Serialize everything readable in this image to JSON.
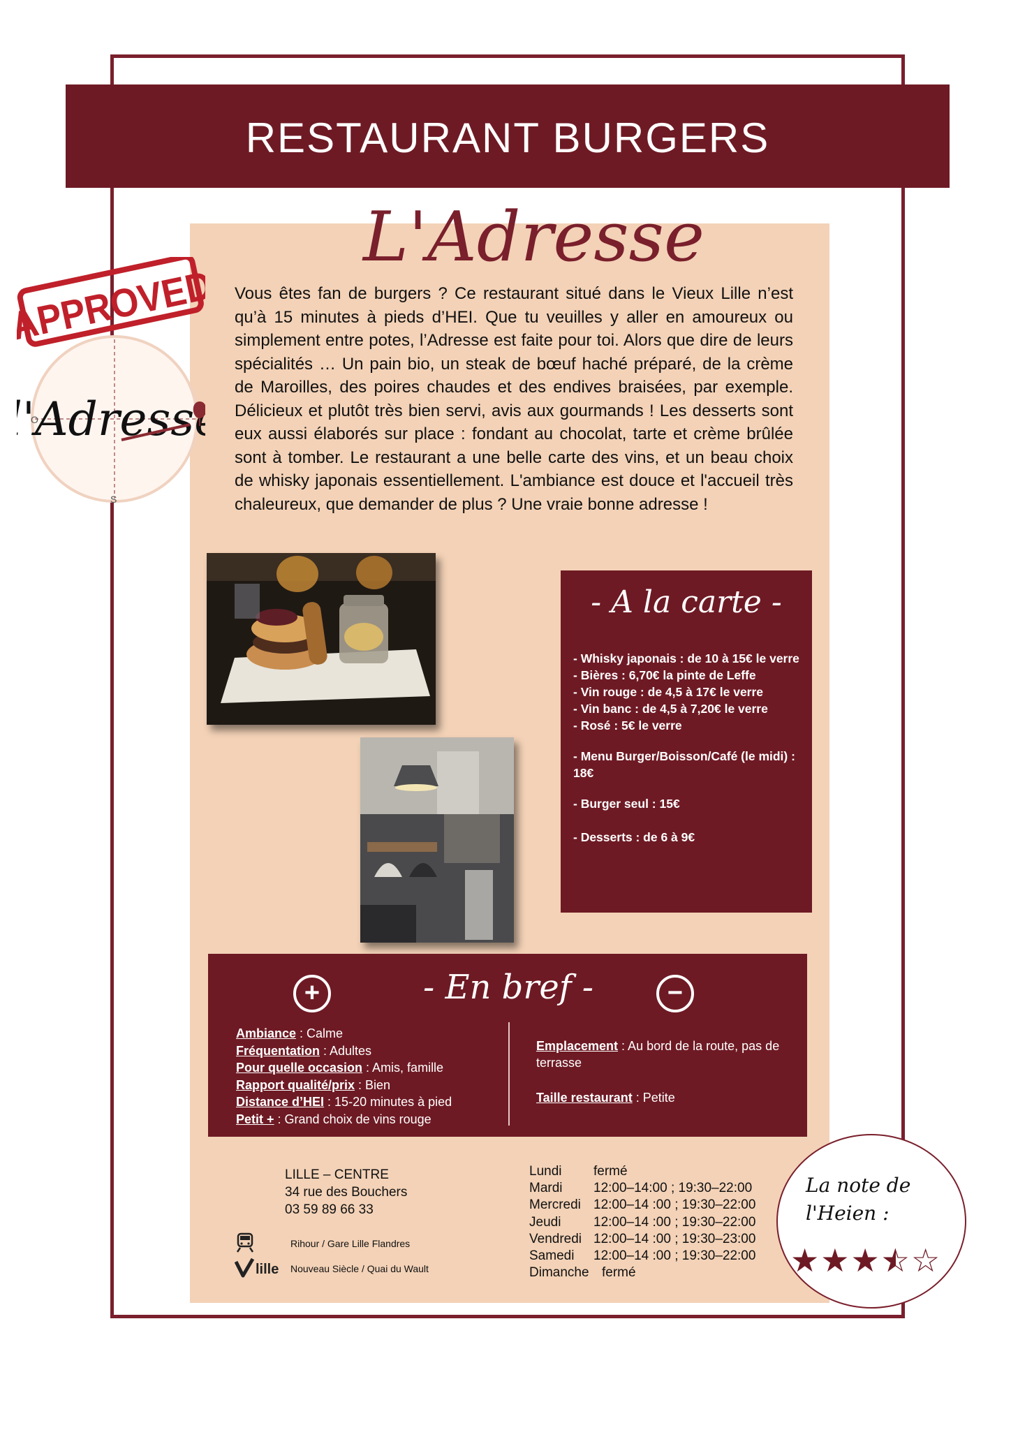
{
  "header": {
    "title": "RESTAURANT BURGERS"
  },
  "brand": {
    "name": "L'Adresse",
    "logo_text": "l'Adresse",
    "stamp_text": "APPROVED",
    "compass_w": "O",
    "compass_s": "S"
  },
  "intro": "Vous êtes fan de burgers ? Ce restaurant situé dans le Vieux Lille n’est qu’à 15 minutes à pieds d’HEI. Que tu veuilles y aller en amoureux ou simplement entre potes, l’Adresse est faite pour toi. Alors que dire de leurs spécialités … Un pain bio, un steak de bœuf haché préparé, de la crème de Maroilles, des poires chaudes et des endives braisées, par exemple. Délicieux et plutôt très bien servi, avis aux gourmands ! Les desserts sont eux aussi élaborés sur place : fondant au chocolat, tarte et crème brûlée sont à tomber. Le restaurant a une belle carte des vins, et un beau choix de whisky japonais essentiellement. L'ambiance est douce et l'accueil très chaleureux, que demander de plus ? Une vraie bonne adresse !",
  "carte": {
    "title": "- A la carte -",
    "items": [
      "- Whisky japonais : de 10 à 15€ le verre",
      "- Bières : 6,70€ la pinte de Leffe",
      "- Vin rouge : de 4,5 à 17€ le verre",
      "- Vin banc : de 4,5 à 7,20€ le verre",
      "- Rosé : 5€ le verre",
      "- Menu Burger/Boisson/Café (le midi) : 18€",
      "- Burger seul : 15€",
      "- Desserts : de 6 à 9€"
    ]
  },
  "bref": {
    "title": "- En bref -",
    "plus_symbol": "+",
    "minus_symbol": "−",
    "plus": [
      {
        "label": "Ambiance",
        "value": " : Calme"
      },
      {
        "label": "Fréquentation",
        "value": " : Adultes"
      },
      {
        "label": "Pour quelle occasion",
        "value": " : Amis, famille"
      },
      {
        "label": "Rapport qualité/prix",
        "value": " : Bien"
      },
      {
        "label": "Distance d’HEI",
        "value": " : 15-20 minutes à pied"
      },
      {
        "label": "Petit +",
        "value": " : Grand choix de vins rouge"
      }
    ],
    "minus": [
      {
        "label": "Emplacement",
        "value": " : Au bord de la route, pas de terrasse"
      },
      {
        "label": "Taille restaurant",
        "value": " : Petite"
      }
    ]
  },
  "address": {
    "area": "LILLE – CENTRE",
    "street": "34 rue des Bouchers",
    "phone": "03 59 89 66 33"
  },
  "transport": {
    "metro": "Rihour / Gare Lille Flandres",
    "vlille_logo": "lille",
    "vlille": "Nouveau Siècle / Quai du Wault"
  },
  "hours": [
    {
      "day": "Lundi",
      "time": "fermé"
    },
    {
      "day": "Mardi",
      "time": "12:00–14:00  ; 19:30–22:00"
    },
    {
      "day": "Mercredi",
      "time": "12:00–14 :00 ; 19:30–22:00"
    },
    {
      "day": "Jeudi",
      "time": "12:00–14 :00 ; 19:30–22:00"
    },
    {
      "day": "Vendredi",
      "time": "12:00–14 :00 ; 19:30–23:00"
    },
    {
      "day": "Samedi",
      "time": "12:00–14 :00 ; 19:30–22:00"
    },
    {
      "day": "Dimanche",
      "time": "fermé"
    }
  ],
  "rating": {
    "label": "La note de l'Heien :",
    "stars_value": 3.5,
    "stars_max": 5
  },
  "colors": {
    "brand": "#6e1a24",
    "beige": "#f3d2b7"
  }
}
